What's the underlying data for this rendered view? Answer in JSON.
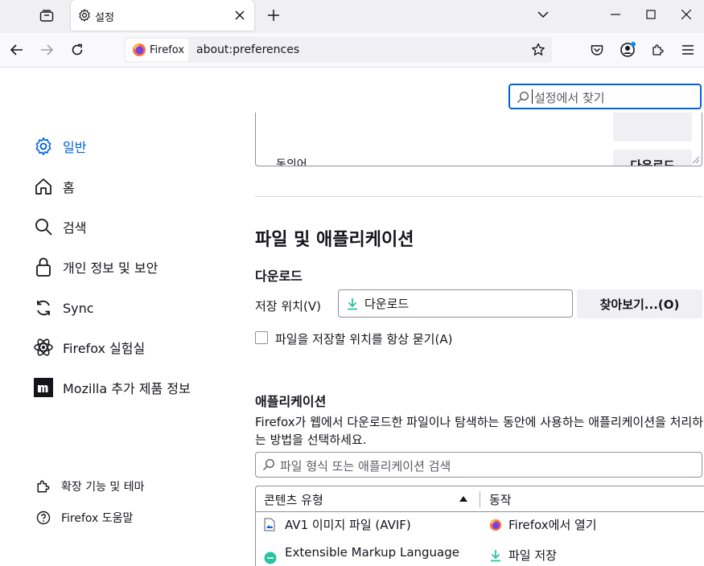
{
  "browser": {
    "tab": {
      "title": "설정"
    },
    "url": {
      "identity": "Firefox",
      "text": "about:preferences"
    }
  },
  "search": {
    "placeholder": "설정에서 찾기"
  },
  "sidebar": {
    "categories": [
      {
        "label": "일반",
        "icon": "gear-icon"
      },
      {
        "label": "홈",
        "icon": "home-icon"
      },
      {
        "label": "검색",
        "icon": "search-icon"
      },
      {
        "label": "개인 정보 및 보안",
        "icon": "lock-icon"
      },
      {
        "label": "Sync",
        "icon": "sync-icon"
      },
      {
        "label": "Firefox 실험실",
        "icon": "flask-atom-icon"
      },
      {
        "label": "Mozilla 추가 제품 정보",
        "icon": "mozilla-m-icon"
      }
    ],
    "footer": [
      {
        "label": "확장 기능 및 테마",
        "icon": "puzzle-icon"
      },
      {
        "label": "Firefox 도움말",
        "icon": "help-icon"
      }
    ]
  },
  "content": {
    "top_box": {
      "text": "동의어",
      "button": "다운로드"
    },
    "files_apps_heading": "파일 및 애플리케이션",
    "downloads": {
      "heading": "다운로드",
      "save_location_label": "저장 위치(V)",
      "folder": "다운로드",
      "browse_button": "찾아보기...(O)",
      "always_ask_label": "파일을 저장할 위치를 항상 묻기(A)"
    },
    "applications": {
      "heading": "애플리케이션",
      "description": "Firefox가 웹에서 다운로드한 파일이나 탐색하는 동안에 사용하는 애플리케이션을 처리하는 방법을 선택하세요.",
      "search_placeholder": "파일 형식 또는 애플리케이션 검색",
      "columns": {
        "type": "콘텐츠 유형",
        "action": "동작"
      },
      "rows": [
        {
          "type": "AV1 이미지 파일 (AVIF)",
          "action": "Firefox에서 열기"
        },
        {
          "type": "Extensible Markup Language",
          "action": "파일 저장"
        }
      ]
    }
  },
  "colors": {
    "accent": "#0061e0",
    "text": "#15141a",
    "chrome": "#f0f0f4"
  }
}
